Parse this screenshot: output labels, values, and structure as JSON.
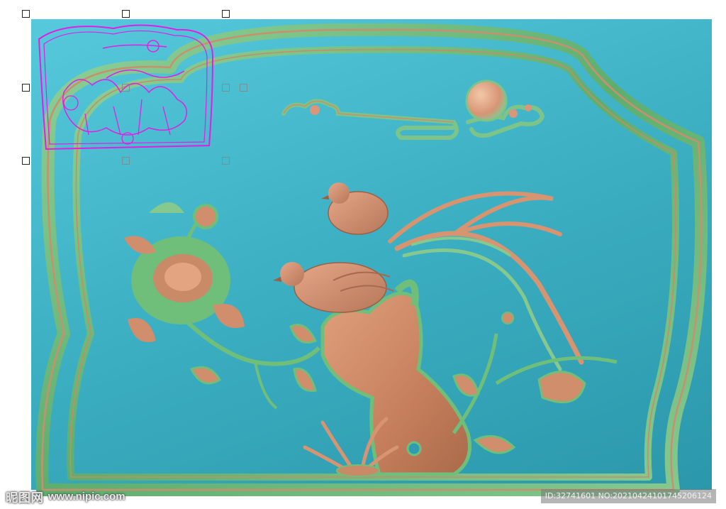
{
  "watermark": {
    "logo": "昵图网",
    "site": "www.nipic.com",
    "id_label": "ID:32741601 NO:20210424101745206124"
  },
  "colors": {
    "background_blue": "#3eb1c4",
    "frame_green": "#6fbf7a",
    "carving_salmon": "#d7936d",
    "preview_magenta": "#e21ee5"
  },
  "icons": {
    "selection_handle": "square-outline-icon"
  }
}
